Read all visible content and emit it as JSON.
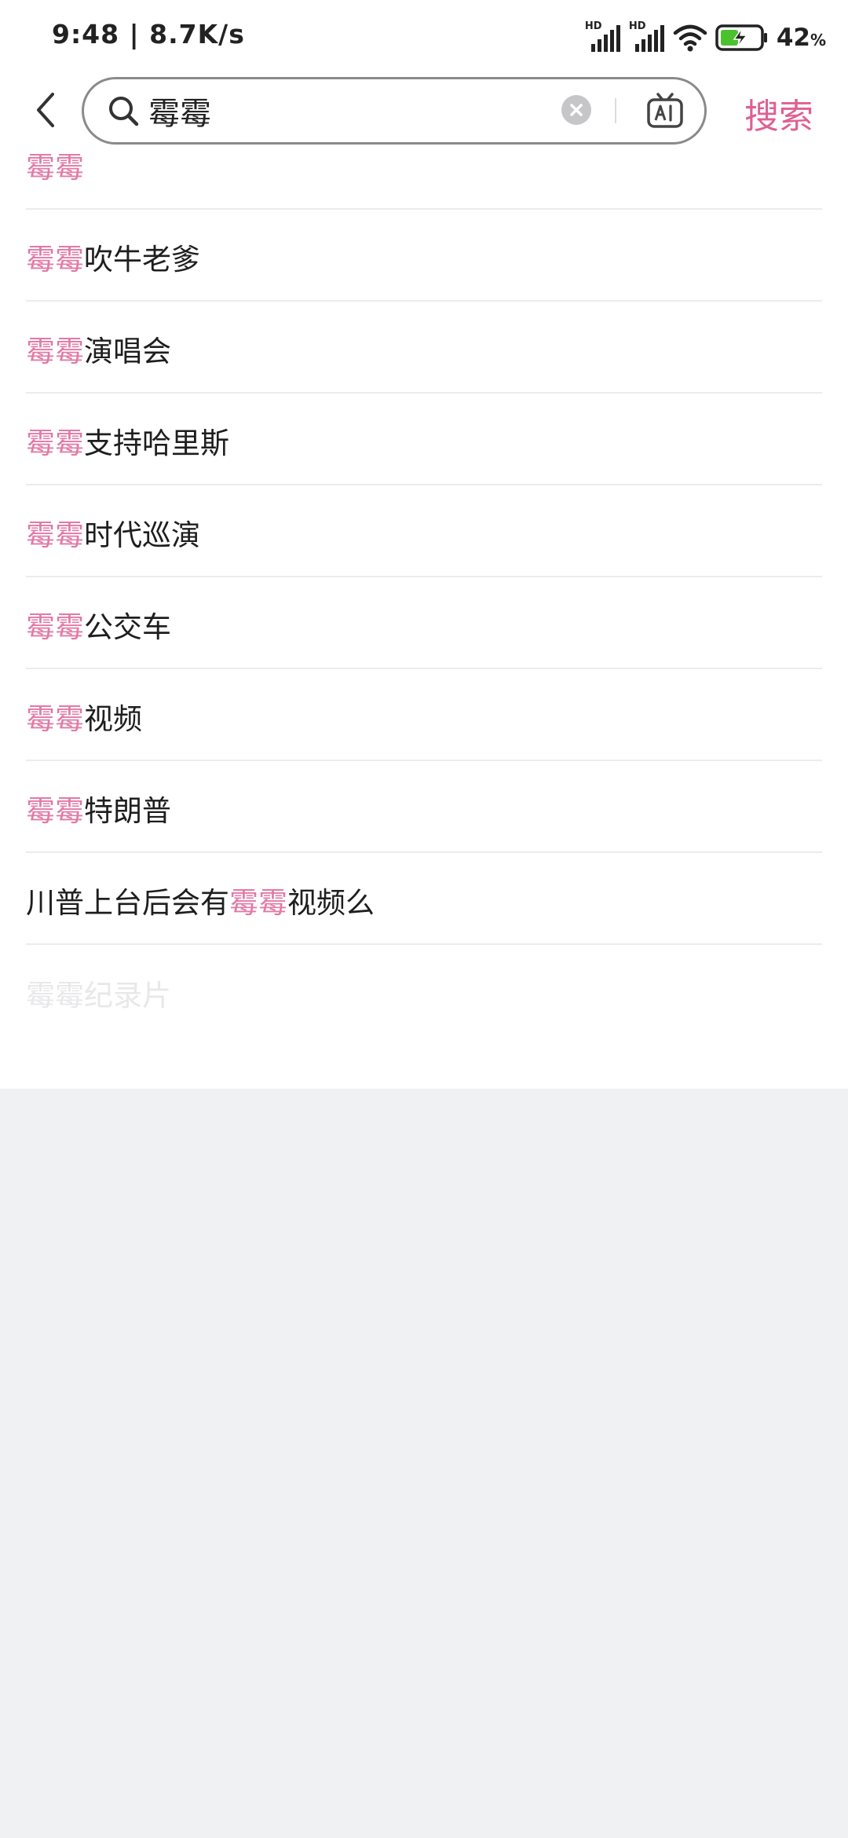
{
  "status_bar": {
    "time_speed": "9:48 | 8.7K/s",
    "sim1_label": "HD",
    "sim2_label": "HD",
    "battery_percent": "42",
    "battery_unit": "%"
  },
  "search": {
    "query": "霉霉",
    "action_label": "搜索"
  },
  "colors": {
    "accent": "#e05f92",
    "highlight": "#e27aa6",
    "background": "#f0f1f3"
  },
  "suggestions": [
    {
      "pre": "",
      "hl": "霉霉",
      "post": ""
    },
    {
      "pre": "",
      "hl": "霉霉",
      "post": "吹牛老爹"
    },
    {
      "pre": "",
      "hl": "霉霉",
      "post": "演唱会"
    },
    {
      "pre": "",
      "hl": "霉霉",
      "post": "支持哈里斯"
    },
    {
      "pre": "",
      "hl": "霉霉",
      "post": "时代巡演"
    },
    {
      "pre": "",
      "hl": "霉霉",
      "post": "公交车"
    },
    {
      "pre": "",
      "hl": "霉霉",
      "post": "视频"
    },
    {
      "pre": "",
      "hl": "霉霉",
      "post": "特朗普"
    },
    {
      "pre": "川普上台后会有",
      "hl": "霉霉",
      "post": "视频么"
    },
    {
      "pre": "",
      "hl": "霉霉",
      "post": "纪录片"
    }
  ],
  "icons": [
    "chevron-left-icon",
    "search-icon",
    "clear-icon",
    "ai-icon",
    "wifi-icon",
    "battery-icon",
    "signal-icon"
  ]
}
